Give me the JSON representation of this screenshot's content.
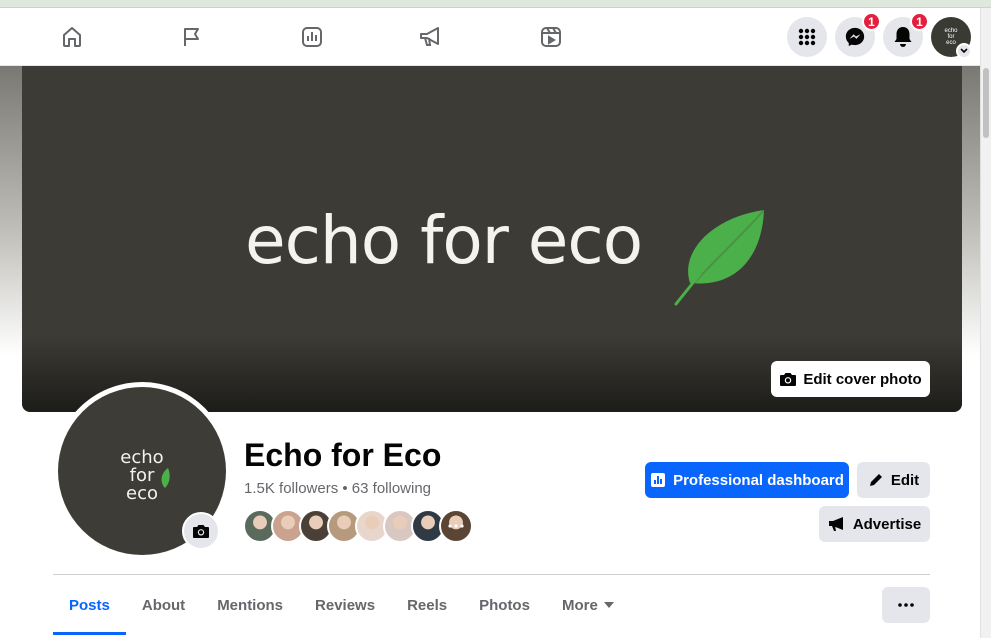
{
  "nav": {
    "icons": [
      "home-icon",
      "flag-icon",
      "insights-icon",
      "megaphone-icon",
      "reels-icon"
    ],
    "menu_icon": "grid-menu-icon",
    "messenger_badge": "1",
    "notifications_badge": "1",
    "account_avatar_text": [
      "echo",
      "for",
      "eco"
    ]
  },
  "cover": {
    "brand_text": "echo for eco",
    "edit_cover_label": "Edit cover photo"
  },
  "profile": {
    "avatar_lines": [
      "echo",
      "for",
      "eco"
    ],
    "name": "Echo for Eco",
    "stats": "1.5K followers • 63 following",
    "follower_avatars": [
      "#5a6b5e",
      "#c9a38e",
      "#4a4038",
      "#b59a7e",
      "#e8d6cc",
      "#d9c7c1",
      "#2f3a45",
      "#5b4636"
    ]
  },
  "actions": {
    "dashboard_label": "Professional dashboard",
    "edit_label": "Edit",
    "advertise_label": "Advertise"
  },
  "tabs": [
    {
      "label": "Posts",
      "active": true
    },
    {
      "label": "About"
    },
    {
      "label": "Mentions"
    },
    {
      "label": "Reviews"
    },
    {
      "label": "Reels"
    },
    {
      "label": "Photos"
    },
    {
      "label": "More"
    }
  ],
  "colors": {
    "accent": "#0866ff",
    "leaf": "#4cb04a",
    "cover_bg": "#3d3b35"
  }
}
